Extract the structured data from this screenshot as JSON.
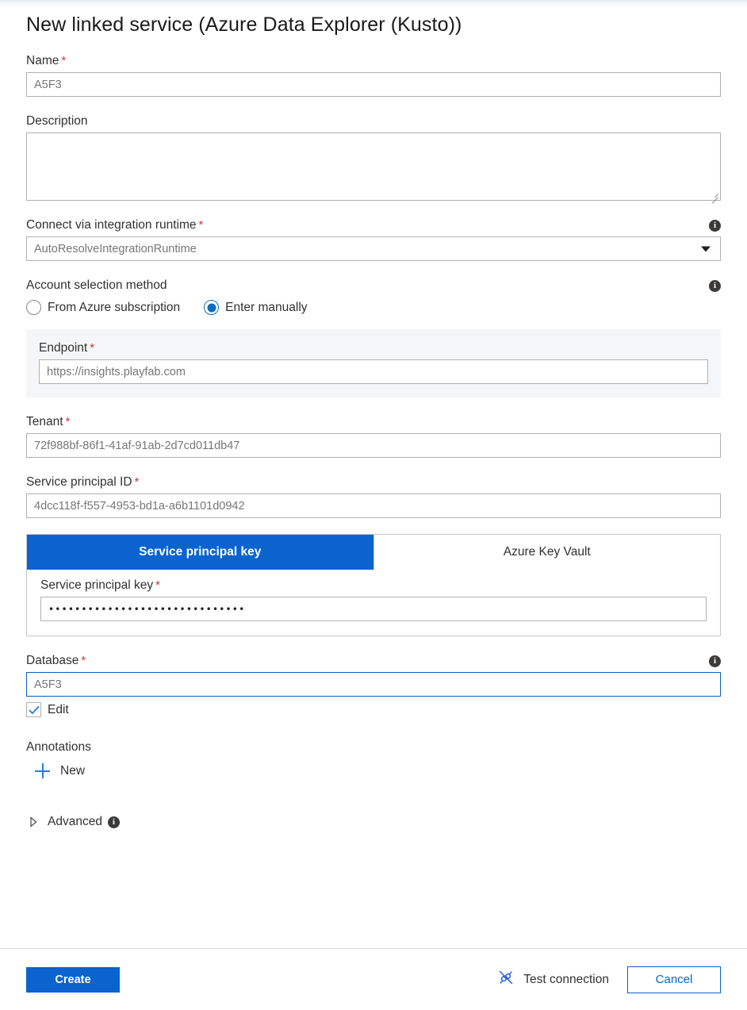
{
  "dialog": {
    "title": "New linked service (Azure Data Explorer (Kusto))"
  },
  "fields": {
    "name": {
      "label": "Name",
      "required": "*",
      "value": "A5F3"
    },
    "description": {
      "label": "Description",
      "value": ""
    },
    "integration_runtime": {
      "label": "Connect via integration runtime",
      "required": "*",
      "value": "AutoResolveIntegrationRuntime",
      "info_icon": "info-icon",
      "caret_icon": "chevron-down-icon"
    },
    "account_selection": {
      "label": "Account selection method",
      "info_icon": "info-icon",
      "options": [
        {
          "label": "From Azure subscription",
          "selected": false
        },
        {
          "label": "Enter manually",
          "selected": true
        }
      ]
    },
    "endpoint": {
      "label": "Endpoint",
      "required": "*",
      "value": "https://insights.playfab.com"
    },
    "tenant": {
      "label": "Tenant",
      "required": "*",
      "value": "72f988bf-86f1-41af-91ab-2d7cd011db47"
    },
    "service_principal_id": {
      "label": "Service principal ID",
      "required": "*",
      "value": "4dcc118f-f557-4953-bd1a-a6b1101d0942"
    },
    "auth_tabs": {
      "tabs": [
        {
          "label": "Service principal key",
          "active": true
        },
        {
          "label": "Azure Key Vault",
          "active": false
        }
      ],
      "key_field": {
        "label": "Service principal key",
        "required": "*",
        "value": "••••••••••••••••••••••••••••••"
      }
    },
    "database": {
      "label": "Database",
      "required": "*",
      "value": "A5F3",
      "info_icon": "info-icon",
      "focused": true
    },
    "edit_checkbox": {
      "label": "Edit",
      "checked": true,
      "icon": "checkmark-icon"
    },
    "annotations": {
      "label": "Annotations",
      "new_label": "New",
      "new_icon": "plus-icon"
    },
    "advanced": {
      "label": "Advanced",
      "expanded": false,
      "chevron_icon": "triangle-right-icon",
      "info_icon": "info-icon"
    }
  },
  "footer": {
    "create_label": "Create",
    "test_connection_label": "Test connection",
    "test_connection_icon": "plug-icon",
    "cancel_label": "Cancel"
  },
  "colors": {
    "accent": "#0a63ce",
    "required": "#d13438",
    "link": "#2b7cd3",
    "panel_bg": "#f5f6f7",
    "border": "#b3b0ad"
  }
}
